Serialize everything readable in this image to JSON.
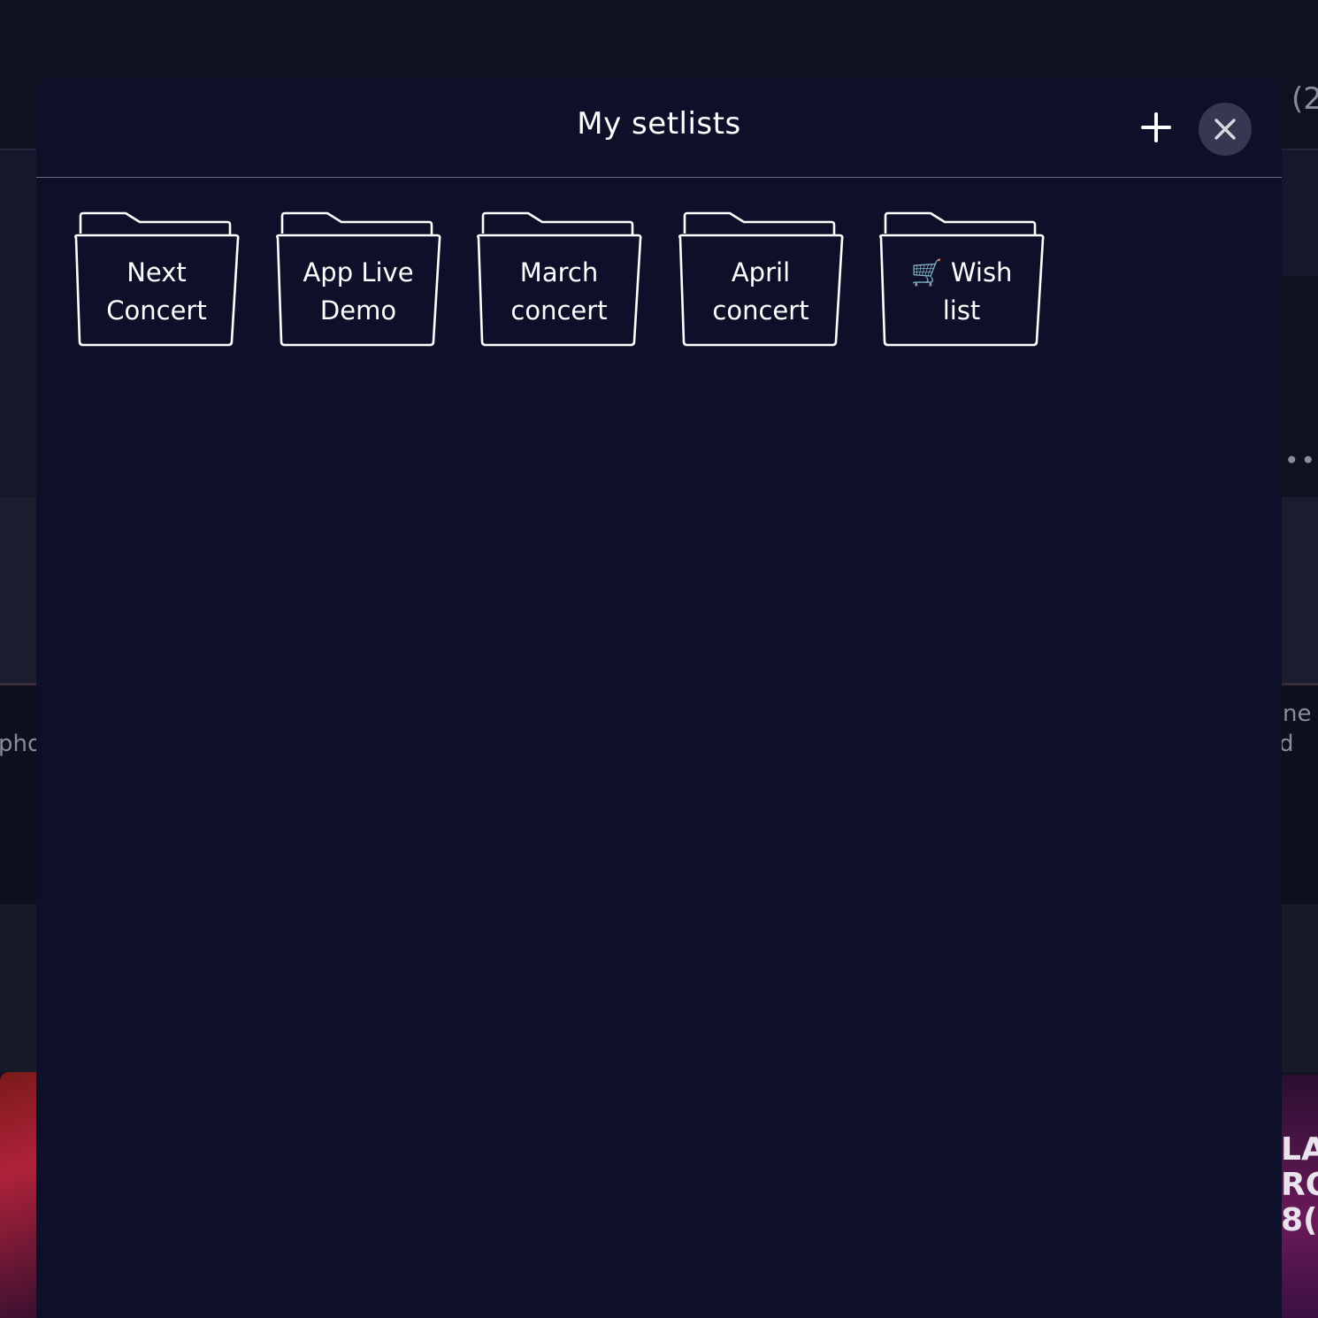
{
  "background": {
    "left_text": "pho",
    "right_top_text": "(2",
    "right_mid_text_1": "ne",
    "right_mid_text_2": "d",
    "right_art_text": "LA\nRO\n8(",
    "more_dots": "•••"
  },
  "modal": {
    "title": "My setlists",
    "add_icon": "plus-icon",
    "close_icon": "close-icon",
    "folders": [
      {
        "label": "Next Concert",
        "icon": "folder-icon"
      },
      {
        "label": "App Live Demo",
        "icon": "folder-icon"
      },
      {
        "label": "March concert",
        "icon": "folder-icon"
      },
      {
        "label": "April concert",
        "icon": "folder-icon"
      },
      {
        "label": "🛒 Wish list",
        "icon": "folder-icon"
      }
    ]
  },
  "colors": {
    "modal_bg": "#0e102a",
    "close_button_bg": "#353850",
    "text": "#ffffff",
    "divider": "#6b6e82"
  }
}
